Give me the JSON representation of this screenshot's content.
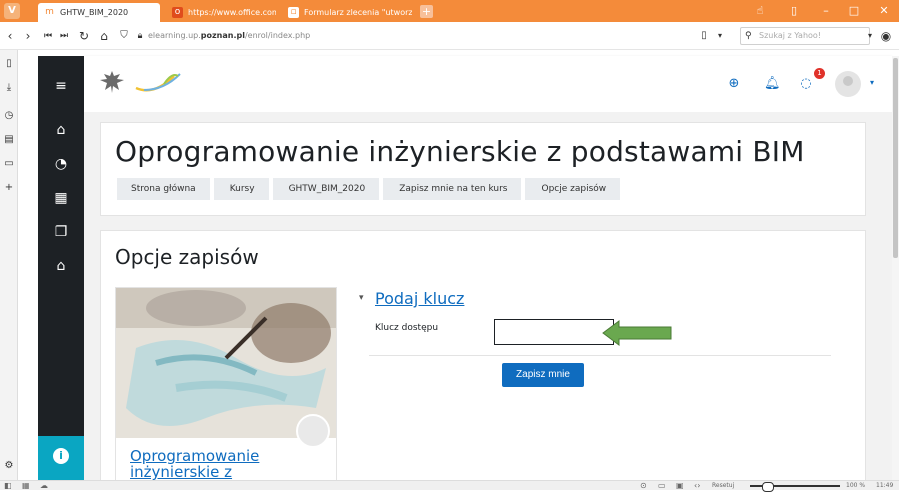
{
  "browser": {
    "tabs": [
      {
        "label": "GHTW_BIM_2020",
        "icon": "moodle-icon",
        "active": true
      },
      {
        "label": "https://www.office.com/?re",
        "icon": "office-icon",
        "active": false
      },
      {
        "label": "Formularz zlecenia \"utworz",
        "icon": "form-icon",
        "active": false
      }
    ],
    "url_prefix": "elearning.up.",
    "url_host": "poznan.pl",
    "url_path": "/enrol/index.php",
    "search_placeholder": "Szukaj z Yahoo!"
  },
  "moodle": {
    "notification_count": "1",
    "course_title": "Oprogramowanie inżynierskie z podstawami BIM",
    "breadcrumbs": [
      "Strona główna",
      "Kursy",
      "GHTW_BIM_2020",
      "Zapisz mnie na ten kurs",
      "Opcje zapisów"
    ],
    "section_title": "Opcje zapisów",
    "course_card_link": "Oprogramowanie inżynierskie z",
    "enrol_heading": "Podaj klucz",
    "key_label": "Klucz dostępu",
    "key_value": "",
    "submit_label": "Zapisz mnie"
  },
  "statusbar": {
    "reset_label": "Resetuj",
    "zoom": "100 %",
    "time": "11:49"
  },
  "colors": {
    "titlebar": "#f48b3a",
    "drawer": "#1d2125",
    "accent": "#0f6cbf",
    "help": "#0aa6c2",
    "arrow": "#6aa84f"
  }
}
